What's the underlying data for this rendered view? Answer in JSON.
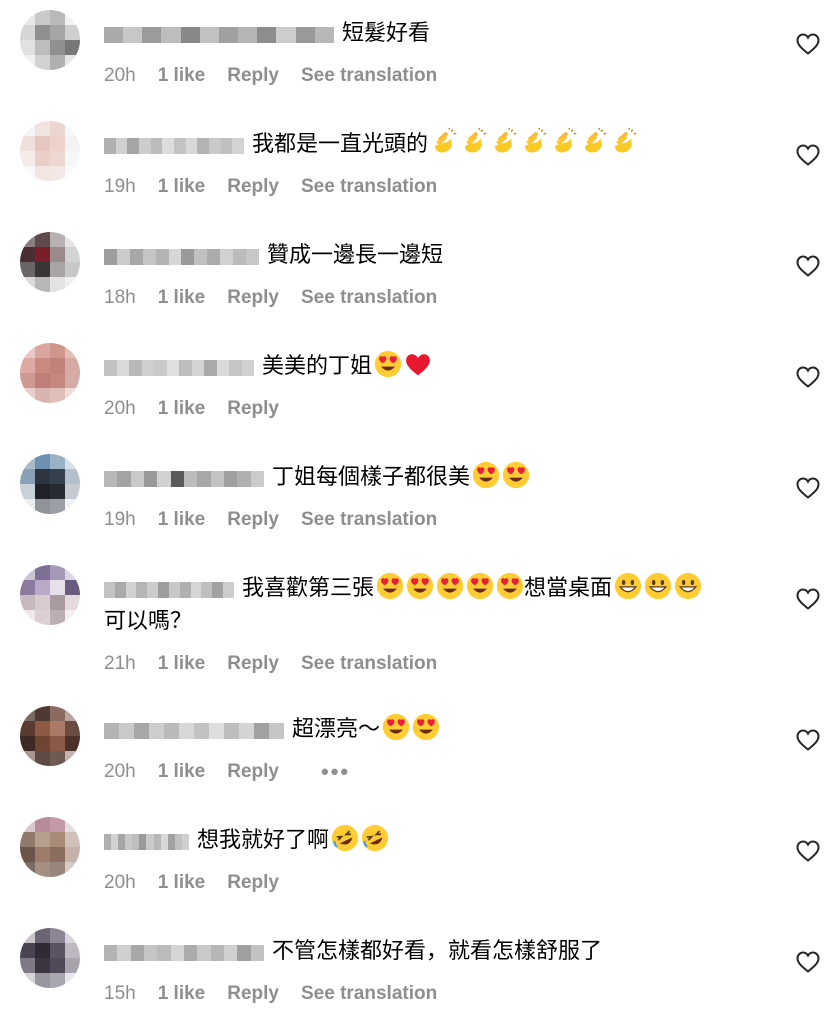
{
  "comments": [
    {
      "text": "短髮好看",
      "emojis": [],
      "time": "20h",
      "likes": "1 like",
      "reply": "Reply",
      "translate": "See translation",
      "avatar_colors": [
        "#e8e8e8",
        "#c9c9c9",
        "#b9b9b9",
        "#f2f2f2",
        "#d6d6d6",
        "#8f8f8f",
        "#a5a5a5",
        "#cfcfcf",
        "#e1e1e1",
        "#bdbdbd",
        "#909090",
        "#777777",
        "#f0f0f0",
        "#d2d2d2",
        "#b0b0b0",
        "#e6e6e6"
      ],
      "username_colors": [
        "#aaaaaa",
        "#c7c7c7",
        "#9b9b9b",
        "#bdbdbd",
        "#888888",
        "#c2c2c2",
        "#a0a0a0",
        "#b5b5b5",
        "#8d8d8d",
        "#cdcdcd",
        "#999999",
        "#b8b8b8"
      ]
    },
    {
      "text": "我都是一直光頭的",
      "emojis": [
        "clap",
        "clap",
        "clap",
        "clap",
        "clap",
        "clap",
        "clap"
      ],
      "time": "19h",
      "likes": "1 like",
      "reply": "Reply",
      "translate": "See translation",
      "avatar_colors": [
        "#f4f4f4",
        "#f1e3df",
        "#ecd6d0",
        "#f6f6f6",
        "#f0e0dc",
        "#e6c7bf",
        "#edd1ca",
        "#f3f3f3",
        "#f5ebe8",
        "#e9cfc8",
        "#ecd7d1",
        "#f7f7f7",
        "#f8f8f8",
        "#f2e6e3",
        "#f3e8e5",
        "#fafafa"
      ],
      "username_colors": [
        "#b0b0b0",
        "#d0d0d0",
        "#a5a5a5",
        "#cccccc",
        "#bcbcbc",
        "#dddddd",
        "#c4c4c4",
        "#d8d8d8",
        "#b3b3b3",
        "#c9c9c9",
        "#bfbfbf",
        "#d3d3d3"
      ]
    },
    {
      "text": "贊成一邊長一邊短",
      "emojis": [],
      "time": "18h",
      "likes": "1 like",
      "reply": "Reply",
      "translate": "See translation",
      "avatar_colors": [
        "#8a7f80",
        "#5c4a4d",
        "#b9b2b3",
        "#e5e5e5",
        "#4a2e33",
        "#7a1f2a",
        "#9a8a8c",
        "#d3d3d3",
        "#6c6567",
        "#3a3537",
        "#a9a4a5",
        "#c8c8c8",
        "#d9d9d9",
        "#b7b7b7",
        "#e3e3e3",
        "#f0f0f0"
      ],
      "username_colors": [
        "#9e9e9e",
        "#cbcbcb",
        "#a8a8a8",
        "#c5c5c5",
        "#b4b4b4",
        "#d6d6d6",
        "#9a9a9a",
        "#c0c0c0",
        "#ababab",
        "#d1d1d1",
        "#bbbbbb",
        "#c7c7c7"
      ]
    },
    {
      "text": "美美的丁姐",
      "emojis": [
        "heart-eyes",
        "red-heart"
      ],
      "time": "20h",
      "likes": "1 like",
      "reply": "Reply",
      "translate": "",
      "avatar_colors": [
        "#e9c9c4",
        "#d9a79f",
        "#cf968d",
        "#e4bdb7",
        "#dcaaa3",
        "#c98a80",
        "#c0827a",
        "#d8aaa3",
        "#cf9991",
        "#bd7f77",
        "#c48880",
        "#d7aba5",
        "#e8cdca",
        "#d9b3ad",
        "#e0bfba",
        "#efdcd9"
      ],
      "username_colors": [
        "#c1c1c1",
        "#d9d9d9",
        "#b7b7b7",
        "#cfcfcf",
        "#c9c9c9",
        "#e0e0e0",
        "#bebebe",
        "#d3d3d3",
        "#a9a9a9",
        "#dadada",
        "#c5c5c5",
        "#d0d0d0"
      ]
    },
    {
      "text": "丁姐每個樣子都很美",
      "emojis": [
        "heart-eyes",
        "heart-eyes"
      ],
      "time": "19h",
      "likes": "1 like",
      "reply": "Reply",
      "translate": "See translation",
      "avatar_colors": [
        "#a9b9c9",
        "#6f8fb0",
        "#9bb1c6",
        "#d7dee5",
        "#8aa0b5",
        "#2c3540",
        "#35404d",
        "#b3c0cc",
        "#c9d1d8",
        "#1f2329",
        "#272c33",
        "#c4cad0",
        "#e9ecef",
        "#8e949a",
        "#9aa0a6",
        "#eff1f3"
      ],
      "username_colors": [
        "#b7b7b7",
        "#a3a3a3",
        "#c9c9c9",
        "#999999",
        "#d1d1d1",
        "#5a5a5a",
        "#bcbcbc",
        "#a7a7a7",
        "#c3c3c3",
        "#9f9f9f",
        "#b0b0b0",
        "#cbcbcb"
      ]
    },
    {
      "text": "我喜歡第三張",
      "text_after": "想當桌面",
      "emojis": [
        "heart-eyes",
        "heart-eyes",
        "heart-eyes",
        "heart-eyes",
        "heart-eyes"
      ],
      "emojis_after": [
        "grin",
        "grin",
        "grin"
      ],
      "text_line2": "可以嗎？",
      "time": "21h",
      "likes": "1 like",
      "reply": "Reply",
      "translate": "See translation",
      "avatar_colors": [
        "#c9c3d3",
        "#7e6f93",
        "#a597b8",
        "#dcd5e3",
        "#8a7b9e",
        "#b9a8c7",
        "#e7dfe9",
        "#6b5b7d",
        "#c7b9c0",
        "#d8cbd0",
        "#a99aa1",
        "#e4dadd",
        "#efe7ea",
        "#ddd0d5",
        "#bcaeb4",
        "#f3eef0"
      ],
      "username_colors": [
        "#c4c4c4",
        "#a9a9a9",
        "#d1d1d1",
        "#b5b5b5",
        "#cccccc",
        "#9e9e9e",
        "#c8c8c8",
        "#b0b0b0",
        "#d6d6d6",
        "#bfbfbf",
        "#a2a2a2",
        "#cdcdcd"
      ]
    },
    {
      "text": "超漂亮～",
      "emojis": [
        "heart-eyes",
        "heart-eyes"
      ],
      "time": "20h",
      "likes": "1 like",
      "reply": "Reply",
      "translate": "",
      "more": "•••",
      "avatar_colors": [
        "#7a6a64",
        "#4e3a33",
        "#8a6b5f",
        "#b6a49d",
        "#5b3b2f",
        "#8e5a44",
        "#a97a65",
        "#6a4b40",
        "#3f2a23",
        "#704432",
        "#8a5a47",
        "#4b3129",
        "#a89790",
        "#5e4b44",
        "#6f5a52",
        "#c2b5b0"
      ],
      "username_colors": [
        "#b4b4b4",
        "#c9c9c9",
        "#a7a7a7",
        "#cecece",
        "#bababa",
        "#d8d8d8",
        "#c2c2c2",
        "#dedede",
        "#bdbdbd",
        "#d4d4d4",
        "#a1a1a1",
        "#c6c6c6"
      ]
    },
    {
      "text": "想我就好了啊",
      "emojis": [
        "rofl",
        "rofl"
      ],
      "time": "20h",
      "likes": "1 like",
      "reply": "Reply",
      "translate": "",
      "avatar_colors": [
        "#d8c7cd",
        "#b98a9b",
        "#c49aa8",
        "#e6dde0",
        "#8f7a6c",
        "#b79f8d",
        "#a88c78",
        "#d0c1b8",
        "#6b5448",
        "#9c7d6b",
        "#8a6d5d",
        "#c5b3a9",
        "#7b6a61",
        "#a58f83",
        "#98857b",
        "#d6ccc7"
      ],
      "username_colors": [
        "#b0b0b0",
        "#d2d2d2",
        "#a6a6a6",
        "#c8c8c8",
        "#bebebe",
        "#9a9a9a",
        "#cacaca",
        "#b7b7b7",
        "#d9d9d9",
        "#a3a3a3",
        "#c1c1c1",
        "#cfcfcf"
      ]
    },
    {
      "text": "不管怎樣都好看，就看怎樣舒服了",
      "emojis": [],
      "time": "15h",
      "likes": "1 like",
      "reply": "Reply",
      "translate": "See translation",
      "avatar_colors": [
        "#c9c5cb",
        "#6b6472",
        "#8c8593",
        "#d9d6db",
        "#4a4352",
        "#2f2a36",
        "#5a5362",
        "#bdb8c1",
        "#7f7885",
        "#3b3542",
        "#504959",
        "#a9a3ae",
        "#d6d3d9",
        "#9a96a0",
        "#aaa6b0",
        "#e8e6ea"
      ],
      "username_colors": [
        "#b3b3b3",
        "#cfcfcf",
        "#a8a8a8",
        "#c5c5c5",
        "#bbbbbb",
        "#d5d5d5",
        "#ababab",
        "#c9c9c9",
        "#b6b6b6",
        "#d0d0d0",
        "#9f9f9f",
        "#c2c2c2"
      ]
    }
  ],
  "icons": {
    "like": "heart-outline-icon",
    "emoji_names": [
      "clap",
      "heart-eyes",
      "red-heart",
      "grin",
      "rofl"
    ]
  },
  "colors": {
    "meta_text": "#8e8e8e",
    "body_text": "#000000",
    "background": "#ffffff"
  }
}
